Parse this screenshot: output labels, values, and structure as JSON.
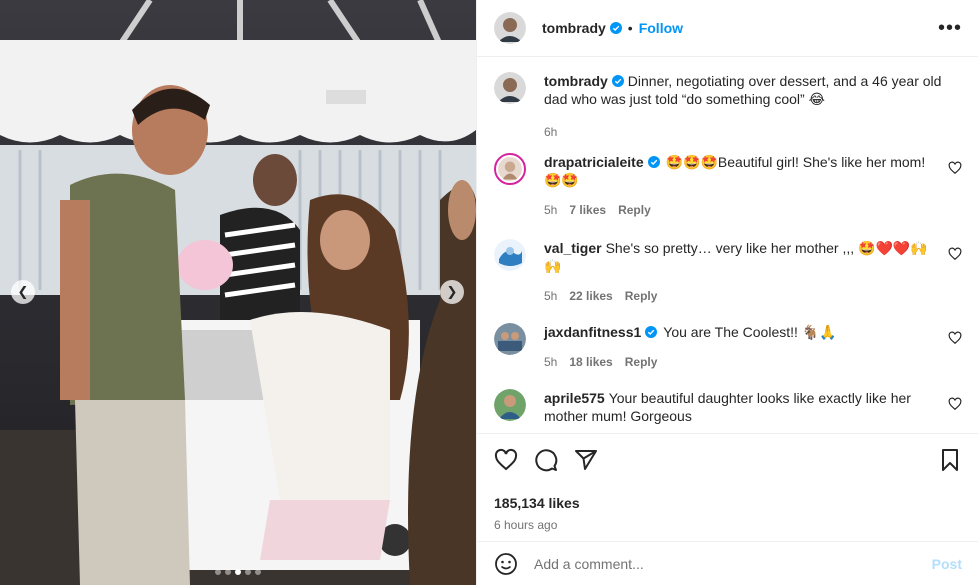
{
  "post": {
    "author": "tombrady",
    "follow_label": "Follow",
    "bullet": "•",
    "more_label": "•••",
    "caption": "Dinner, negotiating over dessert, and a 46 year old dad who was just told “do something cool” 😂",
    "caption_time": "6h",
    "likes": "185,134 likes",
    "time_ago": "6 hours ago",
    "carousel_index": 3,
    "carousel_count": 5
  },
  "comments": [
    {
      "user": "drapatricialeite",
      "verified": true,
      "text": "🤩🤩🤩Beautiful girl! She's like her mom! 🤩🤩",
      "time": "5h",
      "likes": "7 likes",
      "reply": "Reply"
    },
    {
      "user": "val_tiger",
      "verified": false,
      "text": "She's so pretty… very like her mother ,,, 🤩❤️❤️🙌 🙌",
      "time": "5h",
      "likes": "22 likes",
      "reply": "Reply"
    },
    {
      "user": "jaxdanfitness1",
      "verified": true,
      "text": "You are The Coolest!! 🐐🙏",
      "time": "5h",
      "likes": "18 likes",
      "reply": "Reply"
    },
    {
      "user": "aprile575",
      "verified": false,
      "text": "Your beautiful daughter looks like exactly like her mother mum! Gorgeous",
      "time": "",
      "likes": "",
      "reply": ""
    }
  ],
  "add_comment": {
    "placeholder": "Add a comment...",
    "post_label": "Post"
  },
  "colors": {
    "link_blue": "#0095f6",
    "verified_blue": "#0095f6",
    "muted": "#737373",
    "post_disabled": "#b2dffc"
  },
  "icons": [
    "chevron-left-icon",
    "chevron-right-icon",
    "verified-icon",
    "heart-icon",
    "comment-icon",
    "share-icon",
    "bookmark-icon",
    "emoji-icon",
    "more-icon"
  ]
}
